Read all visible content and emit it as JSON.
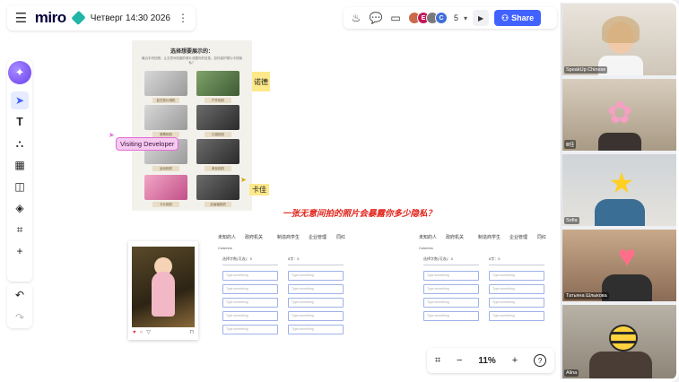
{
  "app": {
    "logo": "miro",
    "board_name": "Четверг 14:30 2026"
  },
  "topbar": {
    "icons": [
      "reactions-icon",
      "comment-icon",
      "video-icon"
    ],
    "avatars": [
      {
        "initial": "",
        "color": "#c96a4a"
      },
      {
        "initial": "E",
        "color": "#c2185b"
      },
      {
        "initial": "",
        "color": "#7a7a7a"
      },
      {
        "initial": "C",
        "color": "#3f6fd8"
      }
    ],
    "collaborator_count": "5",
    "share_label": "Share",
    "share_color": "#4262ff"
  },
  "toolbar": {
    "tools": [
      "select-tool",
      "text-tool",
      "diagram-tool",
      "table-tool",
      "sticky-note-tool",
      "shapes-tool",
      "frame-tool",
      "add-tool"
    ]
  },
  "canvas": {
    "sheet": {
      "title": "选择想要展示的：",
      "subtitle": "最近手机拍照，让无意间拍摄的照片泄露你的信息，如何保护照片中的隐私？",
      "camera_labels": [
        "复古胶片相机",
        "户外相机",
        "便携相机",
        "口袋相机",
        "运动相机",
        "单反相机",
        "卡片相机",
        "全画幅相机"
      ]
    },
    "sticky_1": "诺德",
    "sticky_2": "卡佳",
    "cursor_label": "Visiting Developer",
    "question": "一张无意间拍的照片会暴露你多少隐私？",
    "form_headers": [
      "未知的人",
      "政府机关",
      "制造商学生",
      "企业管理",
      "同红"
    ],
    "columns_label": "Columns",
    "field_1_label": "选择字数(可选)：5",
    "field_2_label": "8字：5",
    "input_placeholder": "Type something"
  },
  "zoom": {
    "value": "11%"
  },
  "video": {
    "participants": [
      {
        "name": "SpeakUp Chinese"
      },
      {
        "name": "Ⅲ佳"
      },
      {
        "name": "Sofia"
      },
      {
        "name": "Татьяна Шлыкова"
      },
      {
        "name": "Alina"
      }
    ]
  }
}
